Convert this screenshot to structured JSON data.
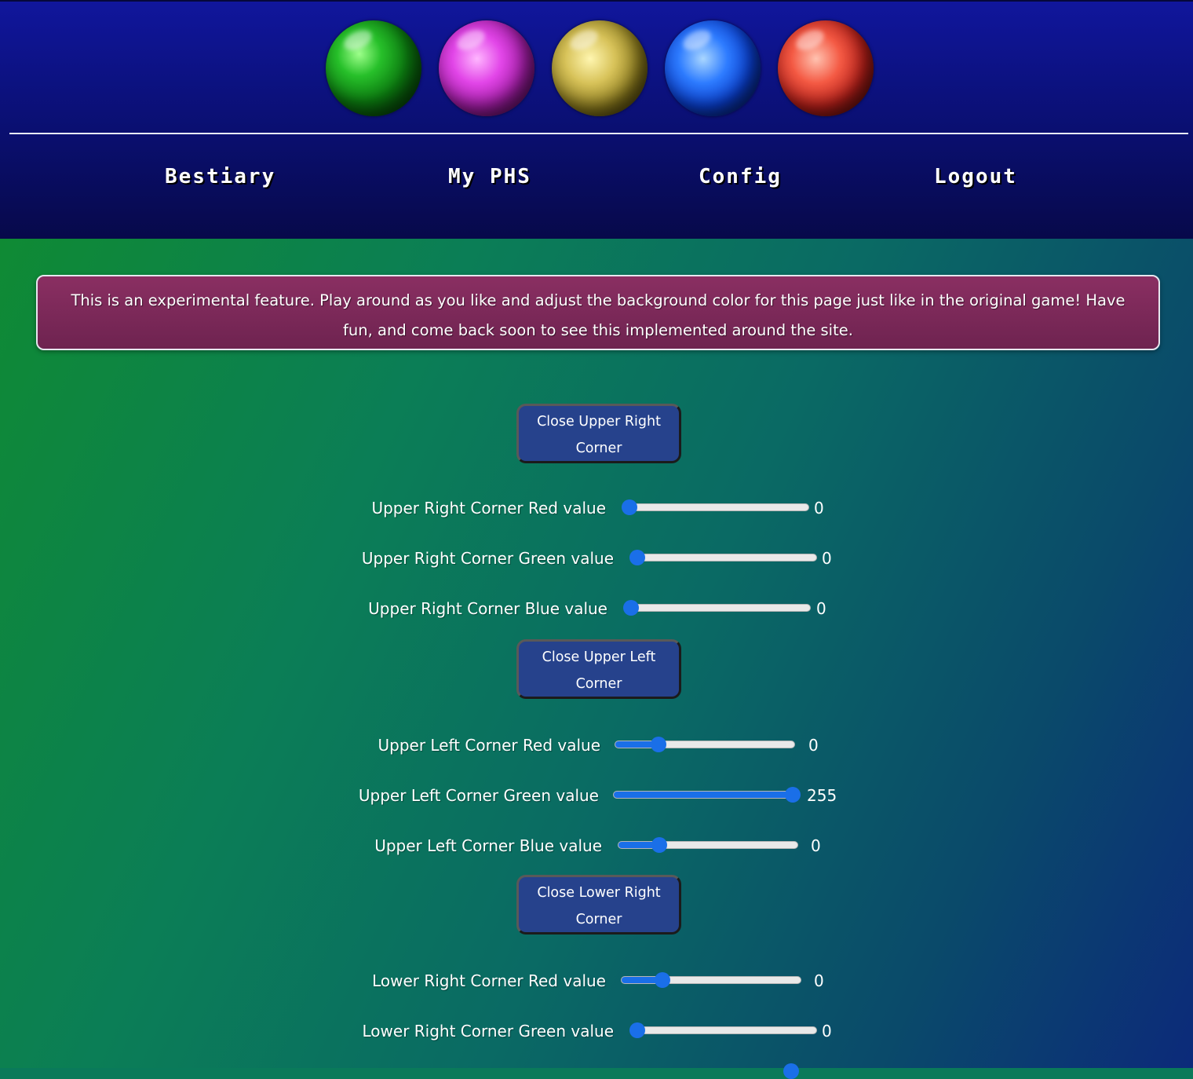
{
  "header": {
    "orbs": [
      {
        "name": "green-orb"
      },
      {
        "name": "purple-orb"
      },
      {
        "name": "yellow-orb"
      },
      {
        "name": "blue-orb"
      },
      {
        "name": "red-orb"
      }
    ],
    "nav": {
      "bestiary": "Bestiary",
      "my_phs": "My PHS",
      "config": "Config",
      "logout": "Logout"
    }
  },
  "notice": {
    "text": "This is an experimental feature. Play around as you like and adjust the background color for this page just like in the original game! Have fun, and come back soon to see this implemented around the site."
  },
  "sections": {
    "upper_right": {
      "button": "Close Upper Right Corner",
      "red_label": "Upper Right Corner Red value",
      "red_value": "0",
      "green_label": "Upper Right Corner Green value",
      "green_value": "0",
      "blue_label": "Upper Right Corner Blue value",
      "blue_value": "0"
    },
    "upper_left": {
      "button": "Close Upper Left Corner",
      "red_label": "Upper Left Corner Red value",
      "red_value": "0",
      "green_label": "Upper Left Corner Green value",
      "green_value": "255",
      "blue_label": "Upper Left Corner Blue value",
      "blue_value": "0"
    },
    "lower_right": {
      "button": "Close Lower Right Corner",
      "red_label": "Lower Right Corner Red value",
      "red_value": "0",
      "green_label": "Lower Right Corner Green value",
      "green_value": "0"
    }
  },
  "colors": {
    "header_blue": "#10169c",
    "notice_bg": "#8a2f62",
    "button_bg": "#26428c",
    "slider_accent": "#1a6fe8"
  }
}
